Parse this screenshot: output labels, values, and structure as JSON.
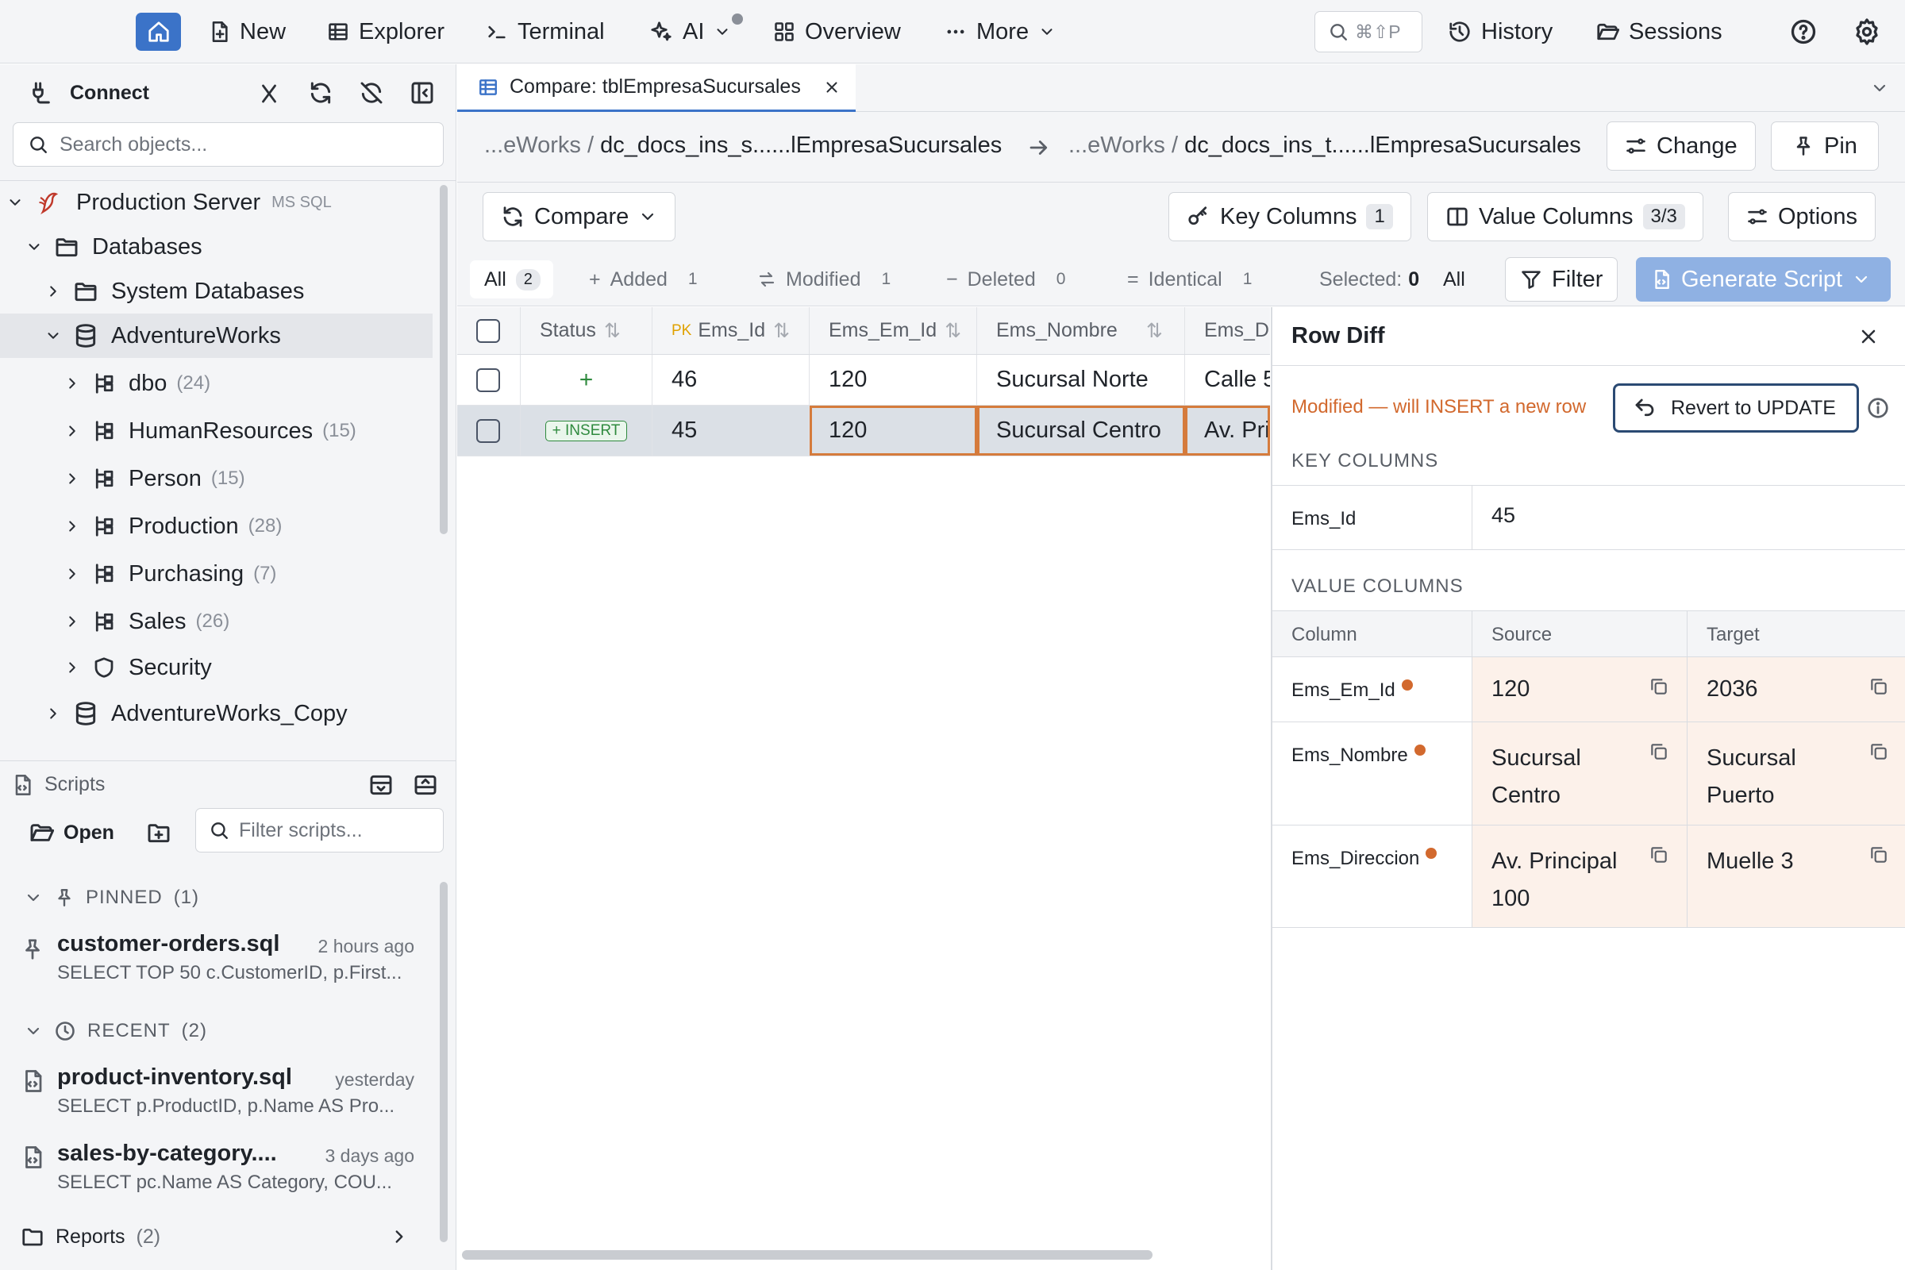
{
  "nav": {
    "new": "New",
    "explorer": "Explorer",
    "terminal": "Terminal",
    "ai": "AI",
    "overview": "Overview",
    "more": "More",
    "search_shortcut": "⌘⇧P",
    "history": "History",
    "sessions": "Sessions"
  },
  "sidebar": {
    "connect": "Connect",
    "search_placeholder": "Search objects...",
    "server_name": "Production Server",
    "server_type": "MS SQL",
    "tree": [
      {
        "label": "Databases",
        "count": ""
      },
      {
        "label": "System Databases",
        "count": ""
      },
      {
        "label": "AdventureWorks",
        "count": ""
      },
      {
        "label": "dbo",
        "count": "(24)"
      },
      {
        "label": "HumanResources",
        "count": "(15)"
      },
      {
        "label": "Person",
        "count": "(15)"
      },
      {
        "label": "Production",
        "count": "(28)"
      },
      {
        "label": "Purchasing",
        "count": "(7)"
      },
      {
        "label": "Sales",
        "count": "(26)"
      },
      {
        "label": "Security",
        "count": ""
      },
      {
        "label": "AdventureWorks_Copy",
        "count": ""
      }
    ]
  },
  "scripts": {
    "title": "Scripts",
    "open": "Open",
    "filter_placeholder": "Filter scripts...",
    "pinned_label": "PINNED",
    "pinned_count": "(1)",
    "recent_label": "RECENT",
    "recent_count": "(2)",
    "items": [
      {
        "name": "customer-orders.sql",
        "when": "2 hours ago",
        "sql": "SELECT TOP 50 c.CustomerID, p.First..."
      },
      {
        "name": "product-inventory.sql",
        "when": "yesterday",
        "sql": "SELECT p.ProductID, p.Name AS Pro..."
      },
      {
        "name": "sales-by-category....",
        "when": "3 days ago",
        "sql": "SELECT pc.Name AS Category, COU..."
      }
    ],
    "reports_label": "Reports",
    "reports_count": "(2)"
  },
  "tab": {
    "label": "Compare: tblEmpresaSucursales"
  },
  "path": {
    "source_prefix": "...eWorks / ",
    "source_name": "dc_docs_ins_s......lEmpresaSucursales",
    "target_prefix": "...eWorks / ",
    "target_name": "dc_docs_ins_t......lEmpresaSucursales",
    "change": "Change",
    "pin": "Pin"
  },
  "toolbar": {
    "compare": "Compare",
    "key_columns": "Key Columns",
    "key_columns_count": "1",
    "value_columns": "Value Columns",
    "value_columns_count": "3/3",
    "options": "Options"
  },
  "filters": {
    "all": "All",
    "all_count": "2",
    "added": "Added",
    "added_count": "1",
    "modified": "Modified",
    "modified_count": "1",
    "deleted": "Deleted",
    "deleted_count": "0",
    "identical": "Identical",
    "identical_count": "1",
    "selected_label": "Selected:",
    "selected_count": "0",
    "select_all": "All",
    "filter": "Filter",
    "generate_script": "Generate Script"
  },
  "grid": {
    "headers": {
      "status": "Status",
      "pk": "PK",
      "ems_id": "Ems_Id",
      "ems_em_id": "Ems_Em_Id",
      "ems_nombre": "Ems_Nombre",
      "ems_d": "Ems_D"
    },
    "rows": [
      {
        "status": "+",
        "ems_id": "46",
        "ems_em_id": "120",
        "ems_nombre": "Sucursal Norte",
        "ems_d": "Calle 5"
      },
      {
        "status": "+ INSERT",
        "ems_id": "45",
        "ems_em_id": "120",
        "ems_nombre": "Sucursal Centro",
        "ems_d": "Av. Pri"
      }
    ]
  },
  "rowdiff": {
    "title": "Row Diff",
    "status_text": "Modified — will INSERT a new row",
    "revert_button": "Revert to UPDATE",
    "key_section": "KEY COLUMNS",
    "key_name": "Ems_Id",
    "key_value": "45",
    "value_section": "VALUE COLUMNS",
    "col_header": "Column",
    "source_header": "Source",
    "target_header": "Target",
    "rows": [
      {
        "column": "Ems_Em_Id",
        "source": "120",
        "target": "2036"
      },
      {
        "column": "Ems_Nombre",
        "source": "Sucursal Centro",
        "target": "Sucursal Puerto"
      },
      {
        "column": "Ems_Direccion",
        "source": "Av. Principal 100",
        "target": "Muelle 3"
      }
    ]
  },
  "colors": {
    "accent": "#3b73c8",
    "modified": "#d2692e",
    "added": "#2f8a3e"
  }
}
